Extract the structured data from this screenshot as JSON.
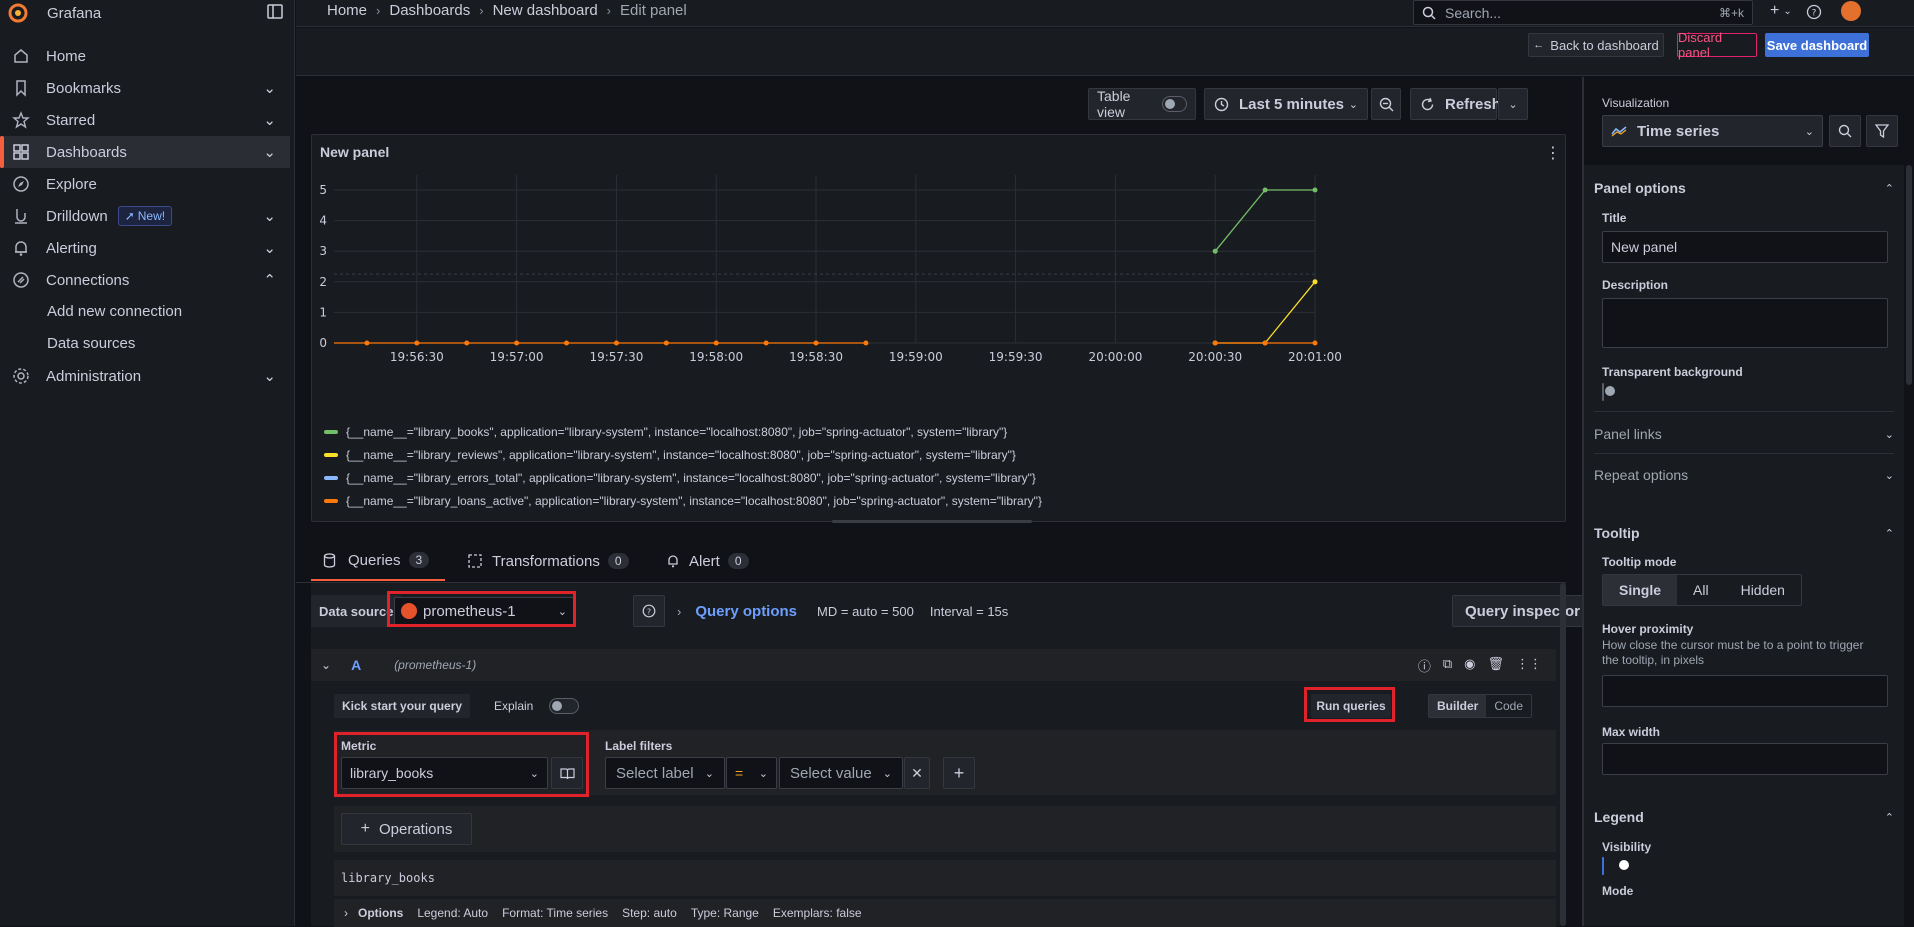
{
  "app": {
    "name": "Grafana"
  },
  "search": {
    "placeholder": "Search...",
    "shortcut": "⌘+k"
  },
  "breadcrumbs": [
    "Home",
    "Dashboards",
    "New dashboard",
    "Edit panel"
  ],
  "sidebar": {
    "items": [
      {
        "label": "Home"
      },
      {
        "label": "Bookmarks"
      },
      {
        "label": "Starred"
      },
      {
        "label": "Dashboards"
      },
      {
        "label": "Explore"
      },
      {
        "label": "Drilldown",
        "badge": "New!"
      },
      {
        "label": "Alerting"
      },
      {
        "label": "Connections"
      },
      {
        "label": "Administration"
      }
    ],
    "sub_items": [
      "Add new connection",
      "Data sources"
    ]
  },
  "edit_toolbar": {
    "back_label": "Back to dashboard",
    "discard_label": "Discard panel",
    "save_label": "Save dashboard"
  },
  "panel_toolbar": {
    "table_view_label": "Table view",
    "time_range_label": "Last 5 minutes",
    "refresh_label": "Refresh"
  },
  "panel": {
    "title": "New panel"
  },
  "chart_data": {
    "type": "line",
    "title": "New panel",
    "ylim": [
      0,
      5
    ],
    "y_ticks": [
      "0",
      "1",
      "2",
      "3",
      "4",
      "5"
    ],
    "x_ticks": [
      "19:56:30",
      "19:57:00",
      "19:57:30",
      "19:58:00",
      "19:58:30",
      "19:59:00",
      "19:59:30",
      "20:00:00",
      "20:00:30",
      "20:01:00"
    ],
    "series": [
      {
        "name": "{__name__=\"library_books\", application=\"library-system\", instance=\"localhost:8080\", job=\"spring-actuator\", system=\"library\"}",
        "color": "#73bf69",
        "points": [
          [
            "20:00:30",
            3
          ],
          [
            "20:00:45",
            5
          ],
          [
            "20:01:00",
            5
          ]
        ]
      },
      {
        "name": "{__name__=\"library_reviews\", application=\"library-system\", instance=\"localhost:8080\", job=\"spring-actuator\", system=\"library\"}",
        "color": "#fade2a",
        "points": [
          [
            "20:00:30",
            0
          ],
          [
            "20:00:45",
            0
          ],
          [
            "20:01:00",
            2
          ]
        ]
      },
      {
        "name": "{__name__=\"library_errors_total\", application=\"library-system\", instance=\"localhost:8080\", job=\"spring-actuator\", system=\"library\"}",
        "color": "#8ab8ff",
        "points": []
      },
      {
        "name": "{__name__=\"library_loans_active\", application=\"library-system\", instance=\"localhost:8080\", job=\"spring-actuator\", system=\"library\"}",
        "color": "#ff780a",
        "points": [
          [
            "19:56:15",
            0
          ],
          [
            "19:56:30",
            0
          ],
          [
            "19:56:45",
            0
          ],
          [
            "19:57:00",
            0
          ],
          [
            "19:57:15",
            0
          ],
          [
            "19:57:30",
            0
          ],
          [
            "19:57:45",
            0
          ],
          [
            "19:58:00",
            0
          ],
          [
            "19:58:15",
            0
          ],
          [
            "19:58:30",
            0
          ],
          [
            "19:58:45",
            0
          ],
          [
            "20:00:30",
            0
          ],
          [
            "20:00:45",
            0
          ],
          [
            "20:01:00",
            0
          ]
        ]
      }
    ]
  },
  "tabs": [
    {
      "label": "Queries",
      "count": "3"
    },
    {
      "label": "Transformations",
      "count": "0"
    },
    {
      "label": "Alert",
      "count": "0"
    }
  ],
  "query_bar": {
    "datasource_label": "Data source",
    "datasource_value": "prometheus-1",
    "query_options_label": "Query options",
    "md_info": "MD = auto = 500",
    "interval_info": "Interval = 15s",
    "inspector_label": "Query inspector"
  },
  "query": {
    "ref_id": "A",
    "datasource_hint": "(prometheus-1)",
    "kick_start_label": "Kick start your query",
    "explain_label": "Explain",
    "run_label": "Run queries",
    "builder_label": "Builder",
    "code_label": "Code",
    "metric_label": "Metric",
    "metric_value": "library_books",
    "label_filters_label": "Label filters",
    "select_label_placeholder": "Select label",
    "operator": "=",
    "select_value_placeholder": "Select value",
    "operations_label": "Operations",
    "raw_query": "library_books",
    "options_label": "Options",
    "options_summary": [
      "Legend: Auto",
      "Format: Time series",
      "Step: auto",
      "Type: Range",
      "Exemplars: false"
    ]
  },
  "options_pane": {
    "visualization_label": "Visualization",
    "visualization_value": "Time series",
    "panel_options_label": "Panel options",
    "title_label": "Title",
    "title_value": "New panel",
    "description_label": "Description",
    "transparent_label": "Transparent background",
    "panel_links_label": "Panel links",
    "repeat_options_label": "Repeat options",
    "tooltip_label": "Tooltip",
    "tooltip_mode_label": "Tooltip mode",
    "tooltip_modes": [
      "Single",
      "All",
      "Hidden"
    ],
    "hover_proximity_label": "Hover proximity",
    "hover_proximity_desc": "How close the cursor must be to a point to trigger the tooltip, in pixels",
    "max_width_label": "Max width",
    "legend_label": "Legend",
    "visibility_label": "Visibility",
    "mode_label": "Mode"
  },
  "colors": {
    "accent": "#3d71d9",
    "brand": "#f55f3e",
    "highlight": "#e0222b"
  }
}
